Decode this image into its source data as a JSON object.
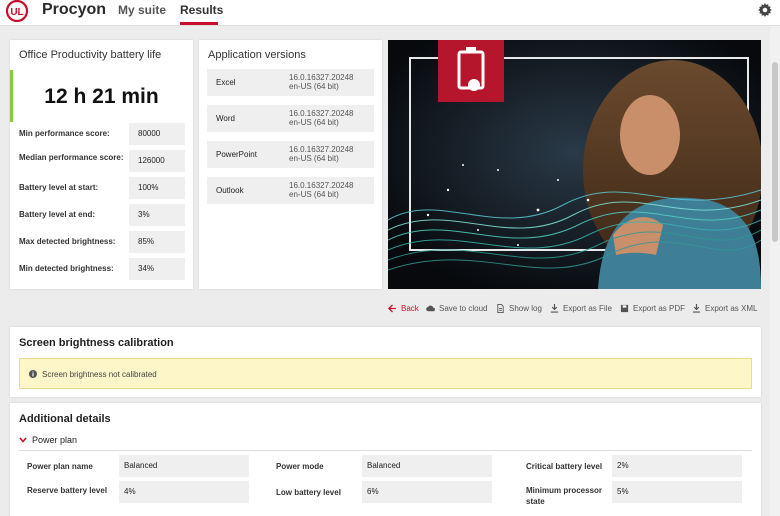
{
  "app": {
    "name": "Procyon"
  },
  "nav": {
    "tabs": [
      "My suite",
      "Results"
    ]
  },
  "battery": {
    "title": "Office Productivity battery life",
    "duration": "12 h 21 min",
    "rows": [
      {
        "label": "Min performance score:",
        "value": "80000"
      },
      {
        "label": "Median performance score:",
        "value": "126000"
      },
      {
        "label": "Battery level at start:",
        "value": "100%"
      },
      {
        "label": "Battery level at end:",
        "value": "3%"
      },
      {
        "label": "Max detected brightness:",
        "value": "85%"
      },
      {
        "label": "Min detected brightness:",
        "value": "34%"
      }
    ]
  },
  "apps": {
    "title": "Application versions",
    "items": [
      {
        "name": "Excel",
        "version": "16.0.16327.20248",
        "locale": "en-US (64 bit)"
      },
      {
        "name": "Word",
        "version": "16.0.16327.20248",
        "locale": "en-US (64 bit)"
      },
      {
        "name": "PowerPoint",
        "version": "16.0.16327.20248",
        "locale": "en-US (64 bit)"
      },
      {
        "name": "Outlook",
        "version": "16.0.16327.20248",
        "locale": "en-US (64 bit)"
      }
    ]
  },
  "actions": {
    "back": "Back",
    "save_cloud": "Save to cloud",
    "show_log": "Show log",
    "export_file": "Export as File",
    "export_pdf": "Export as PDF",
    "export_xml": "Export as XML"
  },
  "brightness": {
    "title": "Screen brightness calibration",
    "notice": "Screen brightness not calibrated"
  },
  "details": {
    "title": "Additional details",
    "power_plan_label": "Power plan",
    "rows": [
      {
        "label": "Power plan name",
        "value": "Balanced"
      },
      {
        "label": "Power mode",
        "value": "Balanced"
      },
      {
        "label": "Critical battery level",
        "value": "2%"
      },
      {
        "label": "Reserve battery level",
        "value": "4%"
      },
      {
        "label": "Low battery level",
        "value": "6%"
      },
      {
        "label": "Minimum processor state",
        "value": "5%"
      }
    ]
  },
  "colors": {
    "accent": "#c8102e",
    "green": "#8cc63f",
    "warn_bg": "#fdf6c8"
  }
}
